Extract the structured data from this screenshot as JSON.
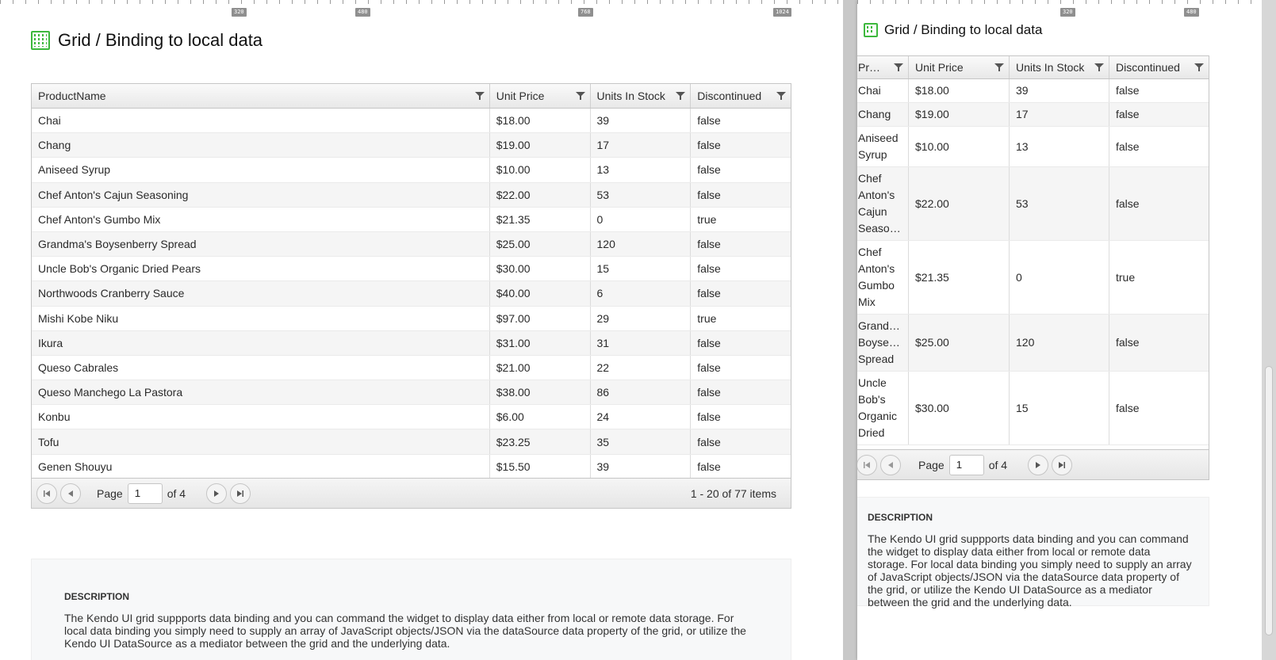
{
  "left": {
    "ruler_ticks": [
      "320",
      "480",
      "768",
      "1024"
    ],
    "title": "Grid / Binding to local data",
    "grid": {
      "columns": [
        "ProductName",
        "Unit Price",
        "Units In Stock",
        "Discontinued"
      ],
      "rows": [
        [
          "Chai",
          "$18.00",
          "39",
          "false"
        ],
        [
          "Chang",
          "$19.00",
          "17",
          "false"
        ],
        [
          "Aniseed Syrup",
          "$10.00",
          "13",
          "false"
        ],
        [
          "Chef Anton's Cajun Seasoning",
          "$22.00",
          "53",
          "false"
        ],
        [
          "Chef Anton's Gumbo Mix",
          "$21.35",
          "0",
          "true"
        ],
        [
          "Grandma's Boysenberry Spread",
          "$25.00",
          "120",
          "false"
        ],
        [
          "Uncle Bob's Organic Dried Pears",
          "$30.00",
          "15",
          "false"
        ],
        [
          "Northwoods Cranberry Sauce",
          "$40.00",
          "6",
          "false"
        ],
        [
          "Mishi Kobe Niku",
          "$97.00",
          "29",
          "true"
        ],
        [
          "Ikura",
          "$31.00",
          "31",
          "false"
        ],
        [
          "Queso Cabrales",
          "$21.00",
          "22",
          "false"
        ],
        [
          "Queso Manchego La Pastora",
          "$38.00",
          "86",
          "false"
        ],
        [
          "Konbu",
          "$6.00",
          "24",
          "false"
        ],
        [
          "Tofu",
          "$23.25",
          "35",
          "false"
        ],
        [
          "Genen Shouyu",
          "$15.50",
          "39",
          "false"
        ]
      ],
      "pager": {
        "page_label": "Page",
        "page_value": "1",
        "of_label": "of 4",
        "info": "1 - 20 of 77 items"
      }
    },
    "description": {
      "title": "DESCRIPTION",
      "text": "The Kendo UI grid suppports data binding and you can command the widget to display data either from local or remote data storage. For local data binding you simply need to supply an array of JavaScript objects/JSON via the dataSource data property of the grid, or utilize the Kendo UI DataSource as a mediator between the grid and the underlying data."
    }
  },
  "right": {
    "ruler_ticks": [
      "320",
      "480"
    ],
    "title": "Grid / Binding to local data",
    "grid": {
      "columns": [
        "Pr…",
        "Unit Price",
        "Units In Stock",
        "Discontinued"
      ],
      "rows": [
        [
          [
            "Chai"
          ],
          "$18.00",
          "39",
          "false"
        ],
        [
          [
            "Chang"
          ],
          "$19.00",
          "17",
          "false"
        ],
        [
          [
            "Aniseed",
            "Syrup"
          ],
          "$10.00",
          "13",
          "false"
        ],
        [
          [
            "Chef",
            "Anton's",
            "Cajun",
            "Seaso…"
          ],
          "$22.00",
          "53",
          "false"
        ],
        [
          [
            "Chef",
            "Anton's",
            "Gumbo",
            "Mix"
          ],
          "$21.35",
          "0",
          "true"
        ],
        [
          [
            "Grand…",
            "Boyse…",
            "Spread"
          ],
          "$25.00",
          "120",
          "false"
        ],
        [
          [
            "Uncle",
            "Bob's",
            "Organic",
            "Dried"
          ],
          "$30.00",
          "15",
          "false"
        ]
      ],
      "pager": {
        "page_label": "Page",
        "page_value": "1",
        "of_label": "of 4"
      }
    },
    "description": {
      "title": "DESCRIPTION",
      "text": "The Kendo UI grid suppports data binding and you can command the widget to display data either from local or remote data storage. For local data binding you simply need to supply an array of JavaScript objects/JSON via the dataSource data property of the grid, or utilize the Kendo UI DataSource as a mediator between the grid and the underlying data."
    }
  },
  "colors": {
    "icon_green": "#3db83d",
    "header_bg": "#eeeeee",
    "alt_row_bg": "#f5f5f5"
  },
  "icons": {
    "title_icon": "grid-icon",
    "filter": "filter-icon",
    "first": "first-page-icon",
    "prev": "prev-page-icon",
    "next": "next-page-icon",
    "last": "last-page-icon"
  }
}
